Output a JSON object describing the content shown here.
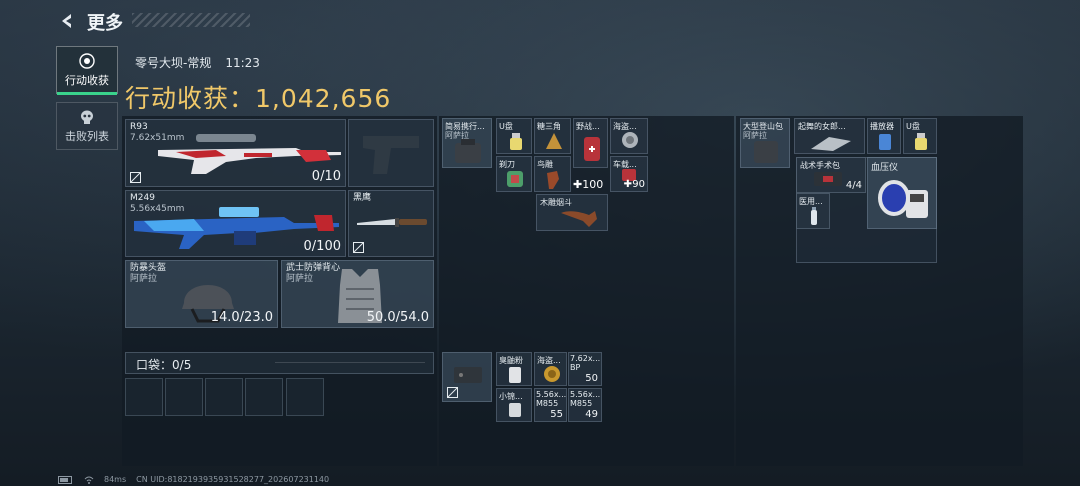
{
  "header": {
    "title": "更多"
  },
  "sidebar": {
    "tabs": [
      {
        "label": "行动收获",
        "icon": "target-icon",
        "active": true
      },
      {
        "label": "击败列表",
        "icon": "skull-icon",
        "active": false
      }
    ]
  },
  "match": {
    "map": "零号大坝-常规",
    "time": "11:23"
  },
  "loot": {
    "label": "行动收获：",
    "value": "1,042,656"
  },
  "weapons": [
    {
      "name": "R93",
      "caliber": "7.62x51mm",
      "ammo": "0/10"
    },
    {
      "name": "M249",
      "caliber": "5.56x45mm",
      "ammo": "0/100"
    }
  ],
  "pistol_slot": {
    "name": ""
  },
  "knife": {
    "name": "黑鹰"
  },
  "helmet": {
    "name": "防暴头盔",
    "brand": "阿萨拉",
    "durability": "14.0/23.0"
  },
  "armor": {
    "name": "武士防弹背心",
    "brand": "阿萨拉",
    "durability": "50.0/54.0"
  },
  "pocket": {
    "label": "口袋：",
    "count": "0/5"
  },
  "backpack": {
    "bag": {
      "name": "简易携行...",
      "brand": "阿萨拉"
    },
    "items": [
      {
        "name": "U盘"
      },
      {
        "name": "糖三角"
      },
      {
        "name": "野战..."
      },
      {
        "name": "海盗..."
      },
      {
        "name": "剃刀"
      },
      {
        "name": "鸟雕"
      },
      {
        "name": "车载...",
        "count": "90"
      },
      {
        "name": "木雕烟斗"
      }
    ],
    "first_aid_count": "100"
  },
  "rig": {
    "items": [
      {
        "name": "臭鼬粉"
      },
      {
        "name": "海盗..."
      },
      {
        "name": "7.62x...",
        "sub": "BP",
        "count": "50"
      },
      {
        "name": "小锦..."
      },
      {
        "name": "5.56x...",
        "sub": "M855",
        "count": "55"
      },
      {
        "name": "5.56x...",
        "sub": "M855",
        "count": "49"
      }
    ]
  },
  "safebox": {
    "bag": {
      "name": "大型登山包",
      "brand": "阿萨拉"
    },
    "items": [
      {
        "name": "起舞的女郎..."
      },
      {
        "name": "播放器"
      },
      {
        "name": "U盘"
      }
    ],
    "case": {
      "name": "战术手术包",
      "count": "4/4"
    },
    "bp_monitor": {
      "name": "血压仪"
    },
    "medic": {
      "name": "医用..."
    }
  },
  "status_bar": {
    "ping": "84ms",
    "uid": "CN UID:8182193935931528277_202607231140"
  },
  "colors": {
    "accent": "#f0c869",
    "active": "#3ad38c",
    "panel": "#1b2632"
  }
}
